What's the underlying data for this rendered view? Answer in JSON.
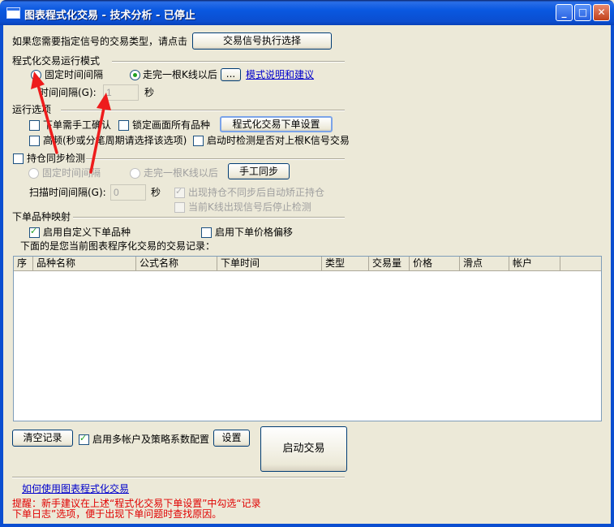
{
  "window": {
    "title": "图表程式化交易 - 技术分析 - 已停止"
  },
  "signal_prompt": {
    "text": "如果您需要指定信号的交易类型，请点击",
    "button_label": "交易信号执行选择"
  },
  "run_mode": {
    "group_label": "程式化交易运行模式",
    "fixed_interval_label": "固定时间间隔",
    "after_kline_label": "走完一根K线以后",
    "ellipsis_button_label": "...",
    "help_link": "模式说明和建议",
    "interval_label": "时间间隔(G):",
    "interval_value": "1",
    "interval_unit": "秒"
  },
  "run_options": {
    "group_label": "运行选项",
    "manual_confirm_label": "下单需手工确认",
    "lock_all_label": "锁定画面所有品种",
    "order_settings_button": "程式化交易下单设置",
    "high_freq_label": "高频(秒或分笔周期请选择该选项)",
    "startup_check_label": "启动时检测是否对上根K信号交易"
  },
  "position_sync": {
    "label": "持仓同步检测",
    "fixed_interval_label": "固定时间间隔",
    "after_kline_label": "走完一根K线以后",
    "manual_sync_button": "手工同步",
    "scan_interval_label": "扫描时间间隔(G):",
    "scan_interval_value": "0",
    "scan_unit": "秒",
    "auto_correct_label": "出现持仓不同步后自动矫正持仓",
    "stop_check_label": "当前K线出现信号后停止检测"
  },
  "order_mapping": {
    "group_label": "下单品种映射",
    "custom_symbol_label": "启用自定义下单品种",
    "price_offset_label": "启用下单价格偏移",
    "records_caption": "下面的是您当前图表程序化交易的交易记录："
  },
  "table": {
    "columns": [
      "序",
      "品种名称",
      "公式名称",
      "下单时间",
      "类型",
      "交易量",
      "价格",
      "滑点",
      "帐户"
    ]
  },
  "bottom": {
    "clear_button": "清空记录",
    "multi_account_label": "启用多帐户及策略系数配置",
    "settings_button": "设置",
    "start_button": "启动交易",
    "how_to_link": "如何使用图表程式化交易",
    "tip_line1": "提醒：新手建议在上述“程式化交易下单设置”中勾选“记录",
    "tip_line2": "下单日志”选项，便于出现下单问题时查找原因。"
  },
  "colors": {
    "accent_red": "#e00000",
    "link_blue": "#0000cc",
    "title_blue": "#0b4ed0"
  }
}
